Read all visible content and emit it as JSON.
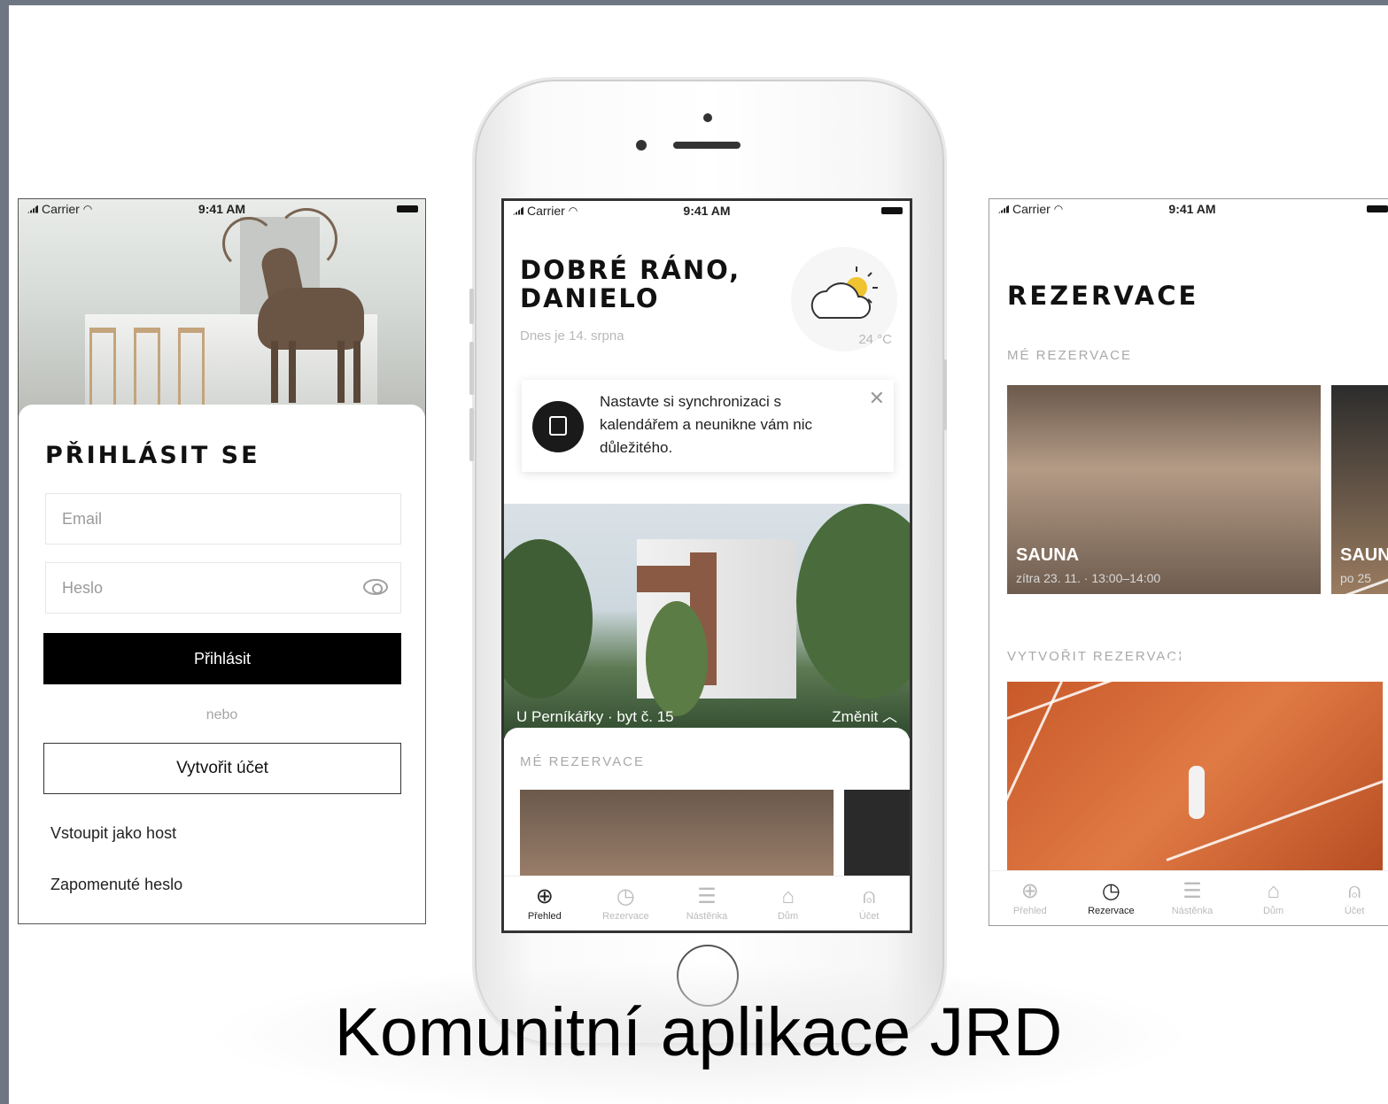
{
  "status_bar": {
    "carrier": "Carrier",
    "time": "9:41 AM"
  },
  "login": {
    "title": "PŘIHLÁSIT SE",
    "email_placeholder": "Email",
    "password_placeholder": "Heslo",
    "login_button": "Přihlásit",
    "or_text": "nebo",
    "create_account_button": "Vytvořit účet",
    "guest_link": "Vstoupit jako host",
    "forgot_link": "Zapomenuté heslo"
  },
  "home": {
    "greeting_line1": "DOBRÉ RÁNO,",
    "greeting_line2": "DANIELO",
    "date_text": "Dnes je 14. srpna",
    "temperature": "24 °C",
    "notification": "Nastavte si synchronizaci s kalendářem a neunikne vám nic důležitého.",
    "address": "U Perníkářky · byt č. 15",
    "change_label": "Změnit",
    "my_reservations_label": "MÉ REZERVACE"
  },
  "tabs": [
    {
      "label": "Přehled",
      "icon": "globe-icon",
      "glyph": "⊕"
    },
    {
      "label": "Rezervace",
      "icon": "clock-icon",
      "glyph": "◷"
    },
    {
      "label": "Nástěnka",
      "icon": "list-icon",
      "glyph": "☰"
    },
    {
      "label": "Dům",
      "icon": "house-icon",
      "glyph": "⌂"
    },
    {
      "label": "Účet",
      "icon": "user-icon",
      "glyph": "⍝"
    }
  ],
  "reservations": {
    "title": "REZERVACE",
    "my_label": "MÉ REZERVACE",
    "create_label": "VYTVOŘIT REZERVACI",
    "items": [
      {
        "name": "SAUNA",
        "time": "zítra 23. 11. · 13:00–14:00"
      },
      {
        "name": "SAUN",
        "time": "po 25"
      }
    ]
  },
  "caption": "Komunitní aplikace JRD",
  "colors": {
    "primary": "#000000",
    "accent_text": "#a9a9a9",
    "sauna_wood": "#8a6e58",
    "tennis_clay": "#d0652f"
  }
}
